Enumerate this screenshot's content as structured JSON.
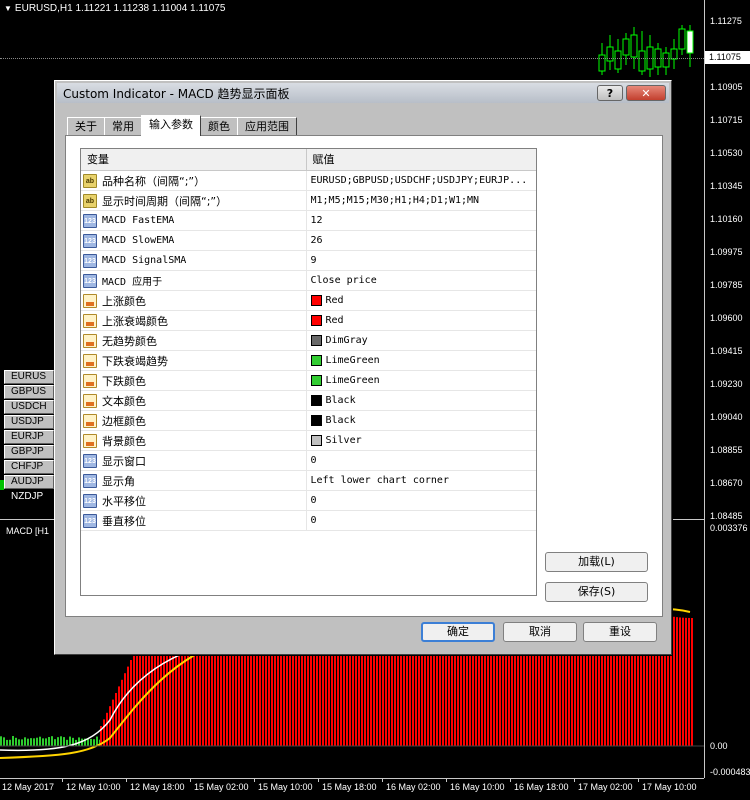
{
  "chart": {
    "symbol_header": "EURUSD,H1  1.11221 1.11238 1.11004 1.11075",
    "price_labels": [
      "1.11275",
      "1.10905",
      "1.10715",
      "1.10530",
      "1.10345",
      "1.10160",
      "1.09975",
      "1.09785",
      "1.09600",
      "1.09415",
      "1.09230",
      "1.09040",
      "1.08855",
      "1.08670",
      "1.08485"
    ],
    "current_price": "1.11075",
    "macd_label": "MACD [H1",
    "macd_labels": [
      "0.003376",
      "0.00",
      "-0.000483"
    ],
    "time_labels": [
      "12 May 2017",
      "12 May 10:00",
      "12 May 18:00",
      "15 May 02:00",
      "15 May 10:00",
      "15 May 18:00",
      "16 May 02:00",
      "16 May 10:00",
      "16 May 18:00",
      "17 May 02:00",
      "17 May 10:00"
    ],
    "symbol_list": [
      {
        "label": "EURUS",
        "active": false
      },
      {
        "label": "GBPUS",
        "active": false
      },
      {
        "label": "USDCH",
        "active": false
      },
      {
        "label": "USDJP",
        "active": false
      },
      {
        "label": "EURJP",
        "active": false
      },
      {
        "label": "GBPJP",
        "active": false
      },
      {
        "label": "CHFJP",
        "active": false
      },
      {
        "label": "AUDJP",
        "active": false
      },
      {
        "label": "NZDJP",
        "active": true
      }
    ]
  },
  "dialog": {
    "title": "Custom Indicator - MACD 趋势显示面板",
    "help_label": "?",
    "close_label": "✕",
    "tabs": [
      "关于",
      "常用",
      "输入参数",
      "颜色",
      "应用范围"
    ],
    "active_tab": 2,
    "grid": {
      "col_variable": "变量",
      "col_value": "赋值",
      "rows": [
        {
          "icon": "ab",
          "name": "品种名称（间隔“;”）",
          "value": "EURUSD;GBPUSD;USDCHF;USDJPY;EURJP...",
          "mono": false
        },
        {
          "icon": "ab",
          "name": "显示时间周期（间隔“;”）",
          "value": "M1;M5;M15;M30;H1;H4;D1;W1;MN",
          "mono": false
        },
        {
          "icon": "num",
          "name": "MACD FastEMA",
          "value": "12",
          "mono": true
        },
        {
          "icon": "num",
          "name": "MACD SlowEMA",
          "value": "26",
          "mono": true
        },
        {
          "icon": "num",
          "name": "MACD SignalSMA",
          "value": "9",
          "mono": true
        },
        {
          "icon": "num",
          "name": "MACD 应用于",
          "value": "Close price",
          "mono": true
        },
        {
          "icon": "color",
          "name": "上涨颜色",
          "value": "Red",
          "swatch": "#ff0000",
          "mono": false
        },
        {
          "icon": "color",
          "name": "上涨衰竭颜色",
          "value": "Red",
          "swatch": "#ff0000",
          "mono": false
        },
        {
          "icon": "color",
          "name": "无趋势颜色",
          "value": "DimGray",
          "swatch": "#696969",
          "mono": false
        },
        {
          "icon": "color",
          "name": "下跌衰竭趋势",
          "value": "LimeGreen",
          "swatch": "#32cd32",
          "mono": false
        },
        {
          "icon": "color",
          "name": "下跌颜色",
          "value": "LimeGreen",
          "swatch": "#32cd32",
          "mono": false
        },
        {
          "icon": "color",
          "name": "文本颜色",
          "value": "Black",
          "swatch": "#000000",
          "mono": false
        },
        {
          "icon": "color",
          "name": "边框颜色",
          "value": "Black",
          "swatch": "#000000",
          "mono": false
        },
        {
          "icon": "color",
          "name": "背景颜色",
          "value": "Silver",
          "swatch": "#c0c0c0",
          "mono": false
        },
        {
          "icon": "num",
          "name": "显示窗口",
          "value": "0",
          "mono": false
        },
        {
          "icon": "num",
          "name": "显示角",
          "value": "Left lower chart corner",
          "mono": false
        },
        {
          "icon": "num",
          "name": "水平移位",
          "value": "0",
          "mono": false
        },
        {
          "icon": "num",
          "name": "垂直移位",
          "value": "0",
          "mono": false
        }
      ]
    },
    "load_label": "加载(L)",
    "save_label": "保存(S)",
    "ok_label": "确定",
    "cancel_label": "取消",
    "reset_label": "重设"
  }
}
